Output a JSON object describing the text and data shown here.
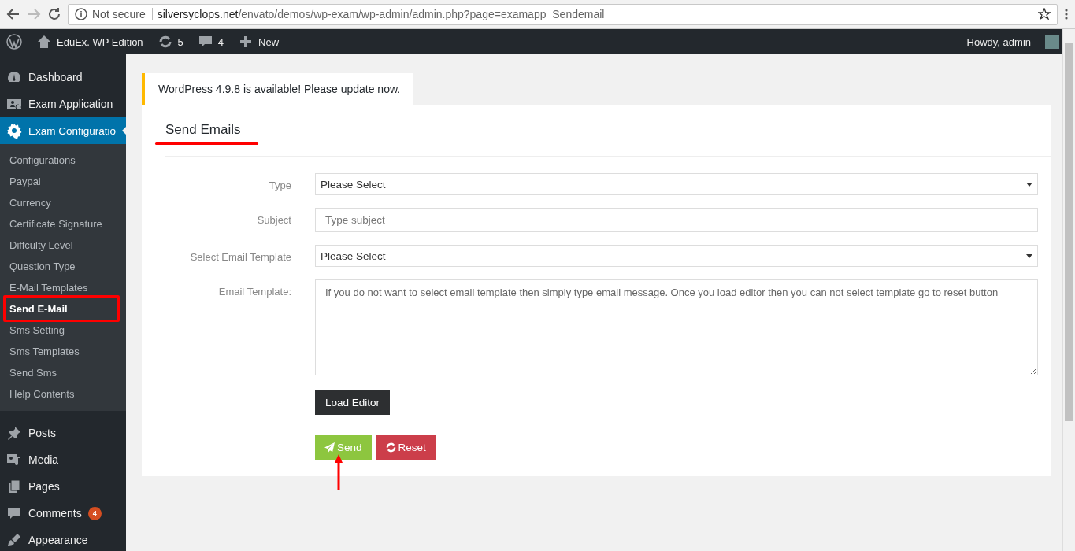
{
  "browser": {
    "security": "Not secure",
    "url_host": "silversyclops.net",
    "url_path": "/envato/demos/wp-exam/wp-admin/admin.php?page=examapp_Sendemail"
  },
  "admin_bar": {
    "site": "EduEx. WP Edition",
    "updates": "5",
    "comments": "4",
    "new": "New",
    "greeting": "Howdy, admin"
  },
  "sidebar": {
    "items": [
      {
        "label": "Dashboard",
        "selected": false
      },
      {
        "label": "Exam Application",
        "selected": false
      },
      {
        "label": "Exam Configuratio",
        "selected": true,
        "children": [
          {
            "label": "Configurations",
            "selected": false,
            "annotated": false
          },
          {
            "label": "Paypal",
            "selected": false,
            "annotated": false
          },
          {
            "label": "Currency",
            "selected": false,
            "annotated": false
          },
          {
            "label": "Certificate Signature",
            "selected": false,
            "annotated": false
          },
          {
            "label": "Diffculty Level",
            "selected": false,
            "annotated": false
          },
          {
            "label": "Question Type",
            "selected": false,
            "annotated": false
          },
          {
            "label": "E-Mail Templates",
            "selected": false,
            "annotated": false
          },
          {
            "label": "Send E-Mail",
            "selected": true,
            "annotated": true
          },
          {
            "label": "Sms Setting",
            "selected": false,
            "annotated": false
          },
          {
            "label": "Sms Templates",
            "selected": false,
            "annotated": false
          },
          {
            "label": "Send Sms",
            "selected": false,
            "annotated": false
          },
          {
            "label": "Help Contents",
            "selected": false,
            "annotated": false
          }
        ]
      },
      {
        "label": "Posts",
        "selected": false
      },
      {
        "label": "Media",
        "selected": false
      },
      {
        "label": "Pages",
        "selected": false
      },
      {
        "label": "Comments",
        "selected": false,
        "badge": "4"
      },
      {
        "label": "Appearance",
        "selected": false
      }
    ]
  },
  "notice": "WordPress 4.9.8 is available! Please update now.",
  "form": {
    "title": "Send Emails",
    "fields": [
      {
        "kind": "select",
        "label": "Type",
        "value": "Please Select"
      },
      {
        "kind": "text",
        "label": "Subject",
        "placeholder": "Type subject"
      },
      {
        "kind": "select",
        "label": "Select Email Template",
        "value": "Please Select"
      },
      {
        "kind": "textarea",
        "label": "Email Template:",
        "placeholder": "If you do not want to select email template then simply type email message. Once you load editor then you can not select template go to reset button"
      }
    ],
    "load_button": "Load Editor",
    "send_button": "Send",
    "reset_button": "Reset"
  }
}
